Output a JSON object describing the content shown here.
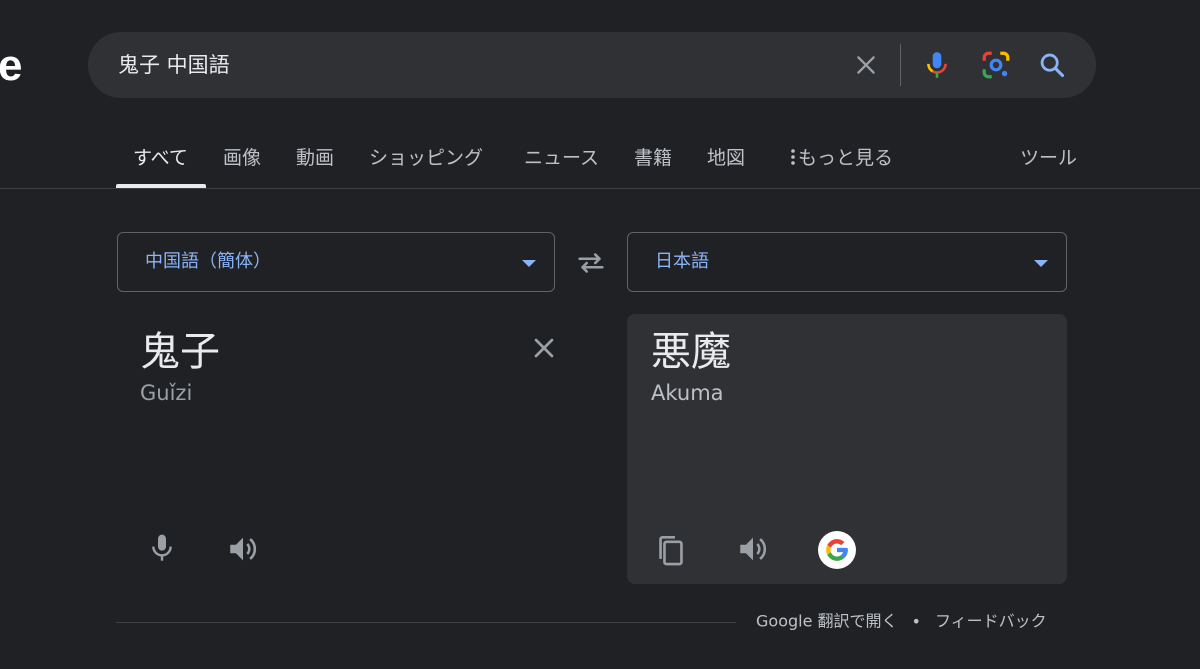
{
  "logo_fragment": "e",
  "search": {
    "query": "鬼子 中国語",
    "clear_icon": "close-icon",
    "mic_icon": "mic-icon",
    "lens_icon": "lens-icon",
    "search_icon": "search-icon"
  },
  "tabs": [
    {
      "label": "すべて",
      "active": true
    },
    {
      "label": "画像"
    },
    {
      "label": "動画"
    },
    {
      "label": "ショッピング"
    },
    {
      "label": "ニュース"
    },
    {
      "label": "書籍"
    },
    {
      "label": "地図"
    },
    {
      "label": "もっと見る"
    }
  ],
  "tools_label": "ツール",
  "translate": {
    "source_lang": "中国語（簡体）",
    "target_lang": "日本語",
    "source_text": "鬼子",
    "source_romanization": "Guǐzi",
    "target_text": "悪魔",
    "target_romanization": "Akuma"
  },
  "footer": {
    "open_link": "Google 翻訳で開く",
    "separator": "•",
    "feedback": "フィードバック"
  },
  "colors": {
    "background": "#202124",
    "surface": "#303134",
    "accent": "#8ab4f8",
    "text": "#e8eaed"
  }
}
